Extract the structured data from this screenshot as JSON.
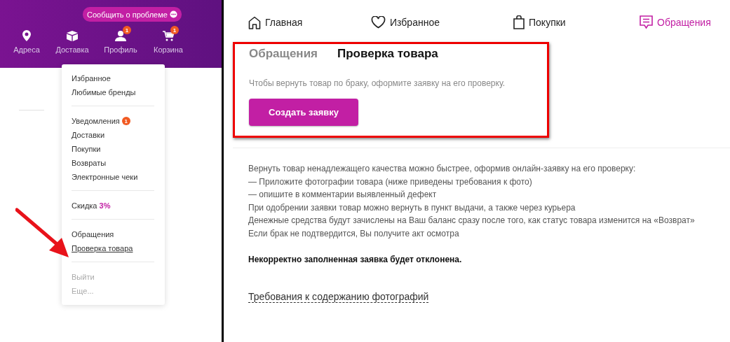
{
  "header": {
    "report_button": "Сообщить о проблеме",
    "nav": [
      {
        "kind": "pin",
        "label": "Адреса"
      },
      {
        "kind": "box",
        "label": "Доставка"
      },
      {
        "kind": "person",
        "label": "Профиль",
        "badge": "1"
      },
      {
        "kind": "cart",
        "label": "Корзина",
        "badge": "1"
      }
    ]
  },
  "menu": {
    "groups": [
      {
        "items": [
          {
            "label": "Избранное",
            "selected": false,
            "muted": false
          },
          {
            "label": "Любимые бренды",
            "selected": false,
            "muted": false
          }
        ]
      },
      {
        "items": [
          {
            "label": "Уведомления",
            "badge": "1",
            "selected": false,
            "muted": false
          },
          {
            "label": "Доставки",
            "selected": false,
            "muted": false
          },
          {
            "label": "Покупки",
            "selected": false,
            "muted": false
          },
          {
            "label": "Возвраты",
            "selected": false,
            "muted": false
          },
          {
            "label": "Электронные чеки",
            "selected": false,
            "muted": false
          }
        ]
      },
      {
        "items": [
          {
            "label": "Скидка **3%**",
            "selected": false,
            "muted": false
          }
        ]
      },
      {
        "items": [
          {
            "label": "Обращения",
            "selected": false,
            "muted": false
          },
          {
            "label": "Проверка товара",
            "selected": true,
            "muted": false
          }
        ]
      },
      {
        "items": [
          {
            "label": "Выйти",
            "selected": false,
            "muted": true
          },
          {
            "label": "Еще...",
            "selected": false,
            "muted": true
          }
        ]
      }
    ]
  },
  "top_nav": [
    {
      "kind": "home",
      "label": "Главная",
      "selected": false
    },
    {
      "kind": "heart",
      "label": "Избранное",
      "selected": false
    },
    {
      "kind": "bag",
      "label": "Покупки",
      "selected": false
    },
    {
      "kind": "chat",
      "label": "Обращения",
      "selected": true
    }
  ],
  "tabs": [
    {
      "label": "Обращения",
      "selected": false
    },
    {
      "label": "Проверка товара",
      "selected": true
    }
  ],
  "intro": "Чтобы вернуть товар по браку, оформите заявку на его проверку.",
  "create_button": "Создать заявку",
  "info_lines": [
    "Вернуть товар ненадлежащего качества можно быстрее, оформив онлайн-заявку на его проверку:",
    "— Приложите фотографии товара (ниже приведены требования к фото)",
    "— опишите в комментарии выявленный дефект",
    "При одобрении заявки товар можно вернуть в пункт выдачи, а также через курьера",
    "Денежные средства будут зачислены на Ваш баланс сразу после того, как статус товара изменится на «Возврат»",
    "Если брак не подтвердится, Вы получите акт осмотра"
  ],
  "warning": "Некорректно заполненная заявка будет отклонена.",
  "requirements_link": "Требования к содержанию фотографий",
  "annotations": {
    "highlight_frame": true,
    "arrow": true
  }
}
